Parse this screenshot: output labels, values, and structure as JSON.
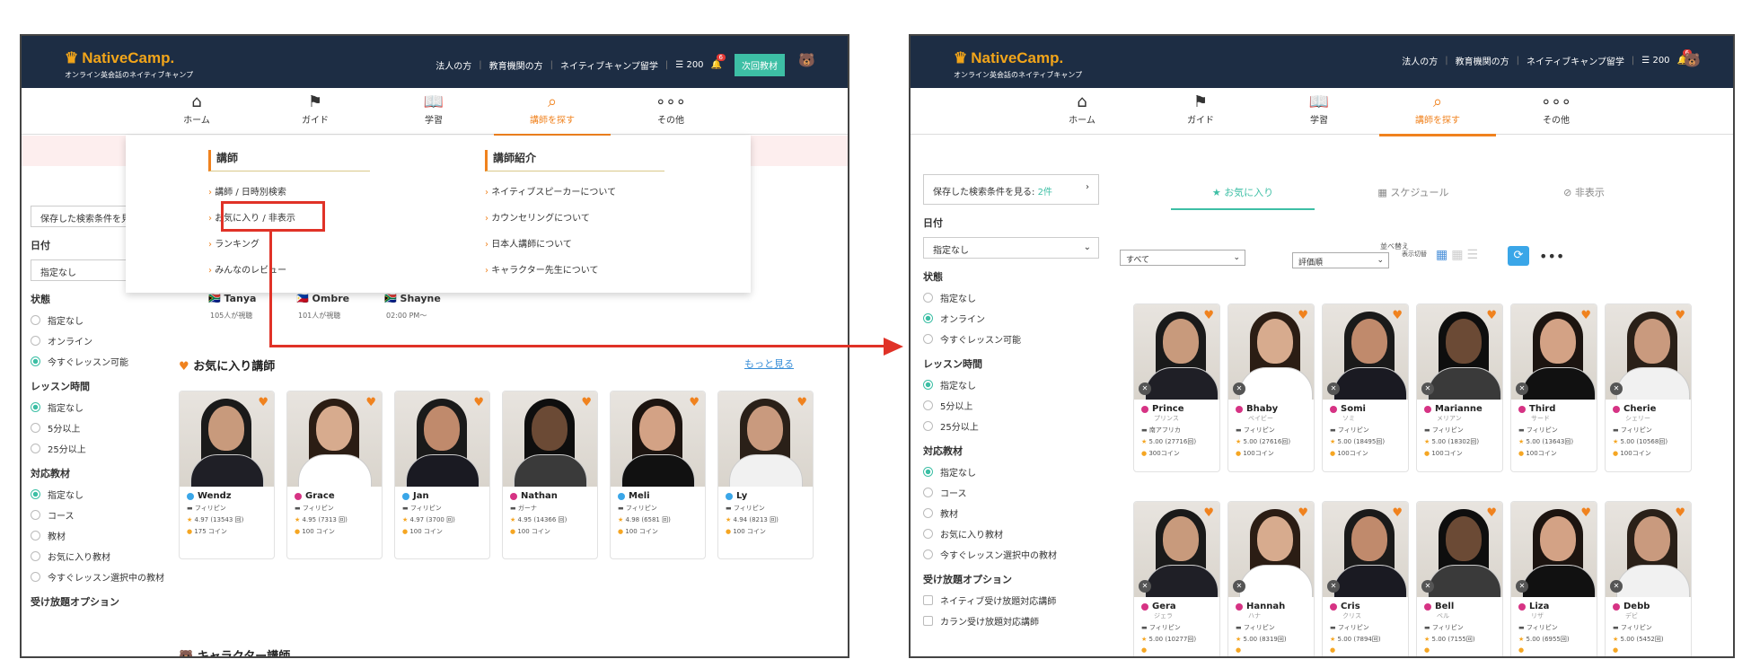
{
  "header": {
    "logo": "NativeCamp.",
    "tagline": "オンライン英会話のネイティブキャンプ",
    "links": [
      "法人の方",
      "教育機関の方",
      "ネイティブキャンプ留学"
    ],
    "coins": "200",
    "notif_count": "6",
    "next_material": "次回教材"
  },
  "nav": [
    {
      "label": "ホーム",
      "icon": "home-icon"
    },
    {
      "label": "ガイド",
      "icon": "signpost-icon"
    },
    {
      "label": "学習",
      "icon": "book-icon"
    },
    {
      "label": "講師を探す",
      "icon": "search-icon"
    },
    {
      "label": "その他",
      "icon": "more-icon"
    }
  ],
  "dropdown": {
    "col1_title": "講師",
    "col1_items": [
      "講師 / 日時別検索",
      "お気に入り / 非表示",
      "ランキング",
      "みんなのレビュー"
    ],
    "col2_title": "講師紹介",
    "col2_items": [
      "ネイティブスピーカーについて",
      "カウンセリングについて",
      "日本人講師について",
      "キャラクター先生について"
    ]
  },
  "left": {
    "saved_search": "保存した検索条件を見る",
    "saved_search_count": "2件",
    "date_label": "日付",
    "date_value": "指定なし",
    "status_label": "状態",
    "status_options": [
      "指定なし",
      "オンライン",
      "今すぐレッスン可能"
    ],
    "time_label": "レッスン時間",
    "time_options": [
      "指定なし",
      "5分以上",
      "25分以上"
    ],
    "material_label": "対応教材",
    "material_options": [
      "指定なし",
      "コース",
      "教材",
      "お気に入り教材",
      "今すぐレッスン選択中の教材"
    ],
    "unlimited_label": "受け放題オプション",
    "unlimited_options": [
      "ネイティブ受け放題対応講師",
      "カラン受け放題対応講師"
    ]
  },
  "live_row": [
    {
      "name": "Tanya",
      "meta": "105人が視聴"
    },
    {
      "name": "Ombre",
      "meta": "101人が視聴"
    },
    {
      "name": "Shayne",
      "meta": "02:00 PM〜"
    }
  ],
  "favorites_title": "お気に入り講師",
  "see_more": "もっと見る",
  "character_title": "キャラクター講師",
  "fav_cards": [
    {
      "name": "Wendz",
      "country": "フィリピン",
      "rating": "4.97",
      "reviews": "(13543 回)",
      "coins": "175 コイン"
    },
    {
      "name": "Grace",
      "country": "フィリピン",
      "rating": "4.95",
      "reviews": "(7313 回)",
      "coins": "100 コイン"
    },
    {
      "name": "Jan",
      "country": "フィリピン",
      "rating": "4.97",
      "reviews": "(3700 回)",
      "coins": "100 コイン"
    },
    {
      "name": "Nathan",
      "country": "ガーナ",
      "rating": "4.95",
      "reviews": "(14366 回)",
      "coins": "100 コイン"
    },
    {
      "name": "Meli",
      "country": "フィリピン",
      "rating": "4.98",
      "reviews": "(6581 回)",
      "coins": "100 コイン"
    },
    {
      "name": "Ly",
      "country": "フィリピン",
      "rating": "4.94",
      "reviews": "(8213 回)",
      "coins": "100 コイン"
    }
  ],
  "right": {
    "tabs": [
      "お気に入り",
      "スケジュール",
      "非表示"
    ],
    "filter_value": "すべて",
    "sort_label": "並べ替え",
    "sort_value": "評価順",
    "display_label": "表示切替"
  },
  "grid_cards": [
    {
      "name": "Prince",
      "kana": "プリンス",
      "country": "南アフリカ",
      "rating": "5.00",
      "reviews": "(27716回)",
      "coins": "300コイン"
    },
    {
      "name": "Bhaby",
      "kana": "ベイビー",
      "country": "フィリピン",
      "rating": "5.00",
      "reviews": "(27616回)",
      "coins": "100コイン"
    },
    {
      "name": "Somi",
      "kana": "ソミ",
      "country": "フィリピン",
      "rating": "5.00",
      "reviews": "(18495回)",
      "coins": "100コイン"
    },
    {
      "name": "Marianne",
      "kana": "メリアン",
      "country": "フィリピン",
      "rating": "5.00",
      "reviews": "(18302回)",
      "coins": "100コイン"
    },
    {
      "name": "Third",
      "kana": "サード",
      "country": "フィリピン",
      "rating": "5.00",
      "reviews": "(13643回)",
      "coins": "100コイン"
    },
    {
      "name": "Cherie",
      "kana": "シェリー",
      "country": "フィリピン",
      "rating": "5.00",
      "reviews": "(10568回)",
      "coins": "100コイン"
    },
    {
      "name": "Gera",
      "kana": "ジェラ",
      "country": "フィリピン",
      "rating": "5.00",
      "reviews": "(10277回)",
      "coins": ""
    },
    {
      "name": "Hannah",
      "kana": "ハナ",
      "country": "フィリピン",
      "rating": "5.00",
      "reviews": "(8319回)",
      "coins": ""
    },
    {
      "name": "Cris",
      "kana": "クリス",
      "country": "フィリピン",
      "rating": "5.00",
      "reviews": "(7894回)",
      "coins": ""
    },
    {
      "name": "Bell",
      "kana": "ベル",
      "country": "フィリピン",
      "rating": "5.00",
      "reviews": "(7155回)",
      "coins": ""
    },
    {
      "name": "Liza",
      "kana": "リザ",
      "country": "フィリピン",
      "rating": "5.00",
      "reviews": "(6955回)",
      "coins": ""
    },
    {
      "name": "Debb",
      "kana": "デビ",
      "country": "フィリピン",
      "rating": "5.00",
      "reviews": "(5452回)",
      "coins": ""
    }
  ]
}
